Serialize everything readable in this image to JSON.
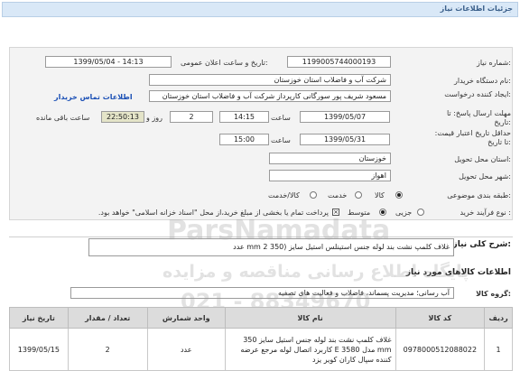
{
  "header": {
    "title": "جزئیات اطلاعات نیاز"
  },
  "fields": {
    "need_number_label": "شماره نیاز:",
    "need_number": "1199005744000193",
    "announce_label": "تاریخ و ساعت اعلان عمومی:",
    "announce_value": "1399/05/04 - 14:13",
    "buyer_label": "نام دستگاه خریدار:",
    "buyer_value": "شرکت آب و فاضلاب استان خوزستان",
    "creator_label": "ایجاد کننده درخواست:",
    "creator_value": "مسعود شریف پور سورگانی کارپرداز شرکت آب و فاضلاب استان خوزستان",
    "contact_link": "اطلاعات تماس خریدار",
    "deadline_label": "مهلت ارسال پاسخ: تا تاریخ:",
    "deadline_date": "1399/05/07",
    "hour_label": "ساعت",
    "deadline_time": "14:15",
    "days_value": "2",
    "day_label": "روز و",
    "remaining_time": "22:50:13",
    "remaining_label": "ساعت باقی مانده",
    "validity_label": "حداقل تاریخ اعتبار قیمت: تا تاریخ:",
    "validity_date": "1399/05/31",
    "hour_label2": "ساعت",
    "validity_time": "15:00",
    "province_label": "استان محل تحویل:",
    "province_value": "خوزستان",
    "city_label": "شهر محل تحویل:",
    "city_value": "اهواز",
    "category_label": "طبقه بندی موضوعی:",
    "category_options": [
      "کالا",
      "خدمت",
      "کالا/خدمت"
    ],
    "category_selected": "کالا",
    "process_label": "نوع فرآیند خرید :",
    "process_options": [
      "جزیی",
      "متوسط"
    ],
    "process_selected": "متوسط",
    "payment_note": "پرداخت تمام یا بخشی از مبلغ خرید،از محل \"اسناد خزانه اسلامی\" خواهد بود."
  },
  "summary": {
    "label": "شرح کلی نیاز:",
    "value": "غلاف کلمپ نشت بند لوله جنس استینلس استیل سایز (350 mm 2 عدد"
  },
  "goods_section": {
    "title": "اطلاعات کالاهای مورد نیاز"
  },
  "goods_group": {
    "label": "گروه کالا:",
    "value": "آب رسانی؛ مدیریت پسماند، فاضلاب و فعالیت های تصفیه"
  },
  "watermark": {
    "line1": "ParsNamadata",
    "line2": "پایگاه اطلاع رسانی مناقصه و مزایده",
    "line3": "021 - 88349670"
  },
  "table": {
    "headers": [
      "ردیف",
      "کد کالا",
      "نام کالا",
      "واحد شمارش",
      "تعداد / مقدار",
      "تاریخ نیاز"
    ],
    "rows": [
      {
        "row": "1",
        "code": "0978000512088022",
        "name": "غلاف کلمپ نشت بند لوله جنس استیل سایز 350 mm مدل E 3580 کاربرد اتصال لوله مرجع عرضه کننده سپال کاران کویر یزد",
        "unit": "عدد",
        "qty": "2",
        "date": "1399/05/15"
      }
    ]
  }
}
